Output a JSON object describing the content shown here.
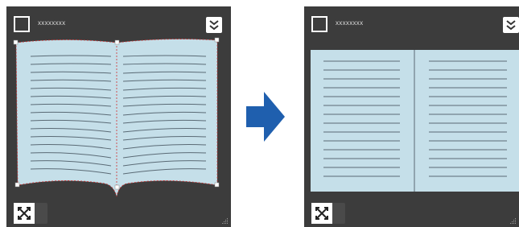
{
  "panels": {
    "left": {
      "title": "xxxxxxxx"
    },
    "right": {
      "title": "xxxxxxxx"
    }
  },
  "colors": {
    "panel_bg": "#3c3c3c",
    "page_fill": "#c5dfe9",
    "arrow": "#1f5fae",
    "guide": "#d03030"
  },
  "icons": {
    "menu": "chevrons-down-icon",
    "toggle": "crossed-arrows-icon",
    "transition": "arrow-right-icon"
  }
}
